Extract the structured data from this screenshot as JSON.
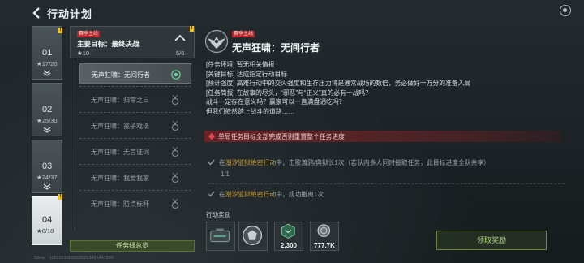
{
  "header": {
    "title": "行动计划"
  },
  "chapters": [
    {
      "num": "01",
      "progress": "17/20"
    },
    {
      "num": "02",
      "progress": "25/30"
    },
    {
      "num": "03",
      "progress": "24/37"
    },
    {
      "num": "04",
      "progress": "0/10"
    }
  ],
  "main_task": {
    "tag": "赛季主线",
    "name": "主要目标：最终决战",
    "stars": "10",
    "count": "5/6"
  },
  "subtasks": [
    {
      "label": "无声狂啸：无间行者"
    },
    {
      "label": "无声狂啸：归零之日"
    },
    {
      "label": "无声狂啸：瓮子戏法"
    },
    {
      "label": "无声狂啸：无言证词"
    },
    {
      "label": "无声狂啸：我爱我家"
    },
    {
      "label": "无声狂啸：防点标杆"
    }
  ],
  "summary_button": "任务线总览",
  "detail": {
    "tag": "赛季主线",
    "title": "无声狂啸：无间行者",
    "lines": [
      {
        "key": "[任务环境]",
        "value": "暂无相关情报"
      },
      {
        "key": "[关键目标]",
        "value": "达成指定行动目标"
      },
      {
        "key": "[预计强度]",
        "value": "高难行动中的交火强度和生存压力将是通常战场的数倍，务必做好十万分的准备入局"
      },
      {
        "key": "[任务简报]",
        "value": "在故事的尽头，“邪恶”与“正义”真的必有一战吗？"
      },
      {
        "key": "",
        "value": "战斗一定存在意义吗？赢家可以一直满盘通吃吗？"
      },
      {
        "key": "",
        "value": "但我们依然踏上战斗的道路……"
      }
    ],
    "warning": "单局任务目标全部完成否则重置整个任务进度",
    "objectives": [
      {
        "prefix": "在",
        "location": "潮汐监狱绝密行动",
        "suffix": "中，击败渡鸦/典狱长1次（若队内多人同时接取任务，此目标进度全队共享）",
        "progress": "1/1"
      },
      {
        "prefix": "在",
        "location": "潮汐监狱绝密行动",
        "suffix": "中，成功撤离1次",
        "progress": ""
      }
    ],
    "rewards_title": "行动奖励",
    "rewards": [
      {
        "icon": "weapon-case-icon",
        "amount": ""
      },
      {
        "icon": "emblem-icon",
        "amount": ""
      },
      {
        "icon": "exp-icon",
        "amount": "2,300"
      },
      {
        "icon": "coin-icon",
        "amount": "777.7K"
      }
    ],
    "claim_button": "领取奖励"
  },
  "footer": {
    "signal": "58ms",
    "uid": "UID 0218895520213425447989"
  },
  "colors": {
    "accent_green": "#b7d88a",
    "warning_red": "#b5242a",
    "location_gold": "#c79b3a"
  }
}
